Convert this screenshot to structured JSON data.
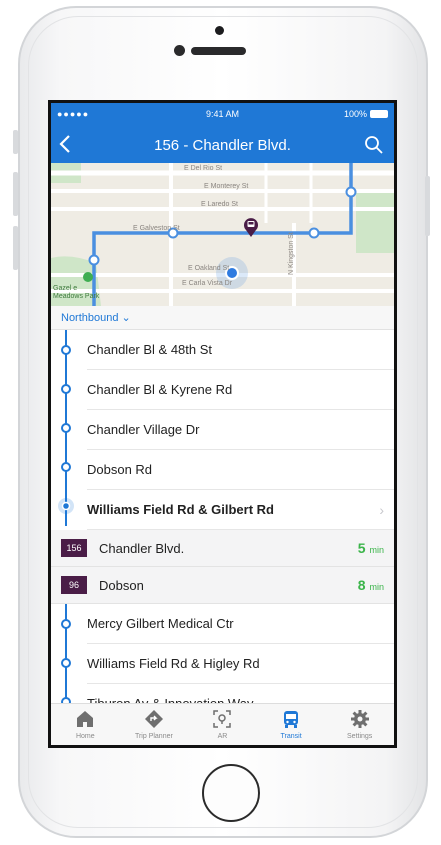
{
  "status_bar": {
    "signal": "●●●●● ",
    "time": "9:41 AM",
    "battery": "100%"
  },
  "navbar": {
    "back_icon": "chevron-left-icon",
    "title": "156 - Chandler Blvd.",
    "search_icon": "search-icon"
  },
  "map": {
    "streets": [
      "E Del Rio St",
      "E Monterey St",
      "E Laredo St",
      "E Galveston St",
      "E Oakland St",
      "E Carla Vista Dr",
      "N Kingston St"
    ],
    "park": "Gazelle Meadows Park",
    "park_visible": "Gazel e\nMeadows Park",
    "route_color": "#4a8fe0",
    "bus_marker_color": "#4a1d47"
  },
  "direction": {
    "label": "Northbound",
    "chevron": "⌄"
  },
  "stops_before": [
    "Chandler Bl & 48th St",
    "Chandler Bl & Kyrene Rd",
    "Chandler Village Dr",
    "Dobson Rd"
  ],
  "current_stop": "Williams Field Rd & Gilbert Rd",
  "arrivals": [
    {
      "route": "156",
      "name": "Chandler Blvd.",
      "eta": "5",
      "unit": "min"
    },
    {
      "route": "96",
      "name": "Dobson",
      "eta": "8",
      "unit": "min"
    }
  ],
  "stops_after": [
    "Mercy Gilbert Medical Ctr",
    "Williams Field Rd & Higley Rd",
    "Tiburon Av & Innovation Way"
  ],
  "tabs": [
    {
      "label": "Home",
      "icon": "home-icon"
    },
    {
      "label": "Trip Planner",
      "icon": "directions-icon"
    },
    {
      "label": "AR",
      "icon": "ar-location-icon"
    },
    {
      "label": "Transit",
      "icon": "bus-icon",
      "active": true
    },
    {
      "label": "Settings",
      "icon": "gear-icon"
    }
  ],
  "colors": {
    "accent": "#1f78d6",
    "eta_green": "#3bb44a",
    "route_badge": "#4a1d47"
  }
}
